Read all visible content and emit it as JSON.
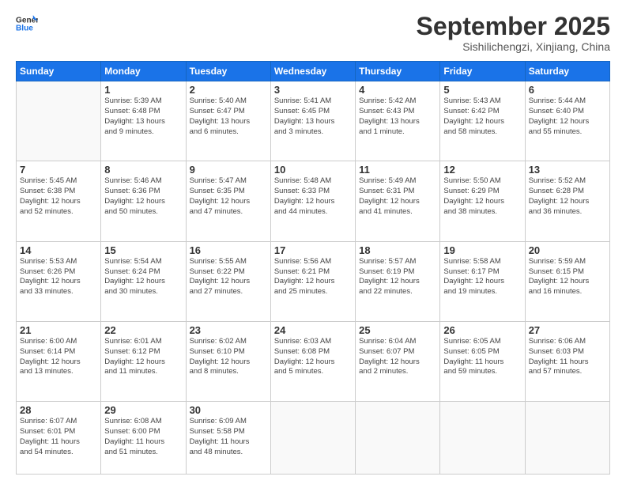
{
  "logo": {
    "line1": "General",
    "line2": "Blue"
  },
  "header": {
    "month": "September 2025",
    "location": "Sishilichengzi, Xinjiang, China"
  },
  "weekdays": [
    "Sunday",
    "Monday",
    "Tuesday",
    "Wednesday",
    "Thursday",
    "Friday",
    "Saturday"
  ],
  "weeks": [
    [
      {
        "day": "",
        "info": ""
      },
      {
        "day": "1",
        "info": "Sunrise: 5:39 AM\nSunset: 6:48 PM\nDaylight: 13 hours\nand 9 minutes."
      },
      {
        "day": "2",
        "info": "Sunrise: 5:40 AM\nSunset: 6:47 PM\nDaylight: 13 hours\nand 6 minutes."
      },
      {
        "day": "3",
        "info": "Sunrise: 5:41 AM\nSunset: 6:45 PM\nDaylight: 13 hours\nand 3 minutes."
      },
      {
        "day": "4",
        "info": "Sunrise: 5:42 AM\nSunset: 6:43 PM\nDaylight: 13 hours\nand 1 minute."
      },
      {
        "day": "5",
        "info": "Sunrise: 5:43 AM\nSunset: 6:42 PM\nDaylight: 12 hours\nand 58 minutes."
      },
      {
        "day": "6",
        "info": "Sunrise: 5:44 AM\nSunset: 6:40 PM\nDaylight: 12 hours\nand 55 minutes."
      }
    ],
    [
      {
        "day": "7",
        "info": "Sunrise: 5:45 AM\nSunset: 6:38 PM\nDaylight: 12 hours\nand 52 minutes."
      },
      {
        "day": "8",
        "info": "Sunrise: 5:46 AM\nSunset: 6:36 PM\nDaylight: 12 hours\nand 50 minutes."
      },
      {
        "day": "9",
        "info": "Sunrise: 5:47 AM\nSunset: 6:35 PM\nDaylight: 12 hours\nand 47 minutes."
      },
      {
        "day": "10",
        "info": "Sunrise: 5:48 AM\nSunset: 6:33 PM\nDaylight: 12 hours\nand 44 minutes."
      },
      {
        "day": "11",
        "info": "Sunrise: 5:49 AM\nSunset: 6:31 PM\nDaylight: 12 hours\nand 41 minutes."
      },
      {
        "day": "12",
        "info": "Sunrise: 5:50 AM\nSunset: 6:29 PM\nDaylight: 12 hours\nand 38 minutes."
      },
      {
        "day": "13",
        "info": "Sunrise: 5:52 AM\nSunset: 6:28 PM\nDaylight: 12 hours\nand 36 minutes."
      }
    ],
    [
      {
        "day": "14",
        "info": "Sunrise: 5:53 AM\nSunset: 6:26 PM\nDaylight: 12 hours\nand 33 minutes."
      },
      {
        "day": "15",
        "info": "Sunrise: 5:54 AM\nSunset: 6:24 PM\nDaylight: 12 hours\nand 30 minutes."
      },
      {
        "day": "16",
        "info": "Sunrise: 5:55 AM\nSunset: 6:22 PM\nDaylight: 12 hours\nand 27 minutes."
      },
      {
        "day": "17",
        "info": "Sunrise: 5:56 AM\nSunset: 6:21 PM\nDaylight: 12 hours\nand 25 minutes."
      },
      {
        "day": "18",
        "info": "Sunrise: 5:57 AM\nSunset: 6:19 PM\nDaylight: 12 hours\nand 22 minutes."
      },
      {
        "day": "19",
        "info": "Sunrise: 5:58 AM\nSunset: 6:17 PM\nDaylight: 12 hours\nand 19 minutes."
      },
      {
        "day": "20",
        "info": "Sunrise: 5:59 AM\nSunset: 6:15 PM\nDaylight: 12 hours\nand 16 minutes."
      }
    ],
    [
      {
        "day": "21",
        "info": "Sunrise: 6:00 AM\nSunset: 6:14 PM\nDaylight: 12 hours\nand 13 minutes."
      },
      {
        "day": "22",
        "info": "Sunrise: 6:01 AM\nSunset: 6:12 PM\nDaylight: 12 hours\nand 11 minutes."
      },
      {
        "day": "23",
        "info": "Sunrise: 6:02 AM\nSunset: 6:10 PM\nDaylight: 12 hours\nand 8 minutes."
      },
      {
        "day": "24",
        "info": "Sunrise: 6:03 AM\nSunset: 6:08 PM\nDaylight: 12 hours\nand 5 minutes."
      },
      {
        "day": "25",
        "info": "Sunrise: 6:04 AM\nSunset: 6:07 PM\nDaylight: 12 hours\nand 2 minutes."
      },
      {
        "day": "26",
        "info": "Sunrise: 6:05 AM\nSunset: 6:05 PM\nDaylight: 11 hours\nand 59 minutes."
      },
      {
        "day": "27",
        "info": "Sunrise: 6:06 AM\nSunset: 6:03 PM\nDaylight: 11 hours\nand 57 minutes."
      }
    ],
    [
      {
        "day": "28",
        "info": "Sunrise: 6:07 AM\nSunset: 6:01 PM\nDaylight: 11 hours\nand 54 minutes."
      },
      {
        "day": "29",
        "info": "Sunrise: 6:08 AM\nSunset: 6:00 PM\nDaylight: 11 hours\nand 51 minutes."
      },
      {
        "day": "30",
        "info": "Sunrise: 6:09 AM\nSunset: 5:58 PM\nDaylight: 11 hours\nand 48 minutes."
      },
      {
        "day": "",
        "info": ""
      },
      {
        "day": "",
        "info": ""
      },
      {
        "day": "",
        "info": ""
      },
      {
        "day": "",
        "info": ""
      }
    ]
  ]
}
